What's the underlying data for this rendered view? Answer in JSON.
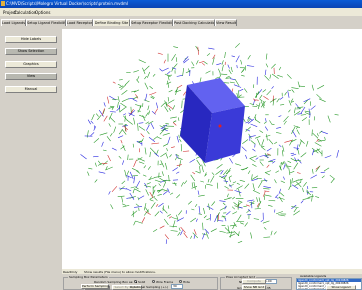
{
  "window": {
    "title": "C:\\MVD\\Scripts\\Molegro Virtual Docker\\scripts\\protein.mvdml"
  },
  "menu": {
    "items": [
      "Project",
      "Calculation",
      "Options"
    ]
  },
  "tabs": [
    "Load Ligands",
    "Setup Ligand Flexibility",
    "Load Receptor",
    "Define Binding Site",
    "Setup Receptor Flexibility",
    "Post Docking Calculation",
    "View Results"
  ],
  "sidebar": {
    "buttons": [
      "Hide Labels",
      "Show Selection",
      "Graphics",
      "View",
      "Manual"
    ]
  },
  "status": {
    "mode": "ReadOnly",
    "message": "Show results (File menu) to allow modifications."
  },
  "sampling": {
    "title": "Sampling Box Parameters",
    "random_label": "Random Sampling Box as:",
    "options": [
      "Solid",
      "Wire Frame",
      "Hide"
    ],
    "selected_option": "Solid",
    "reset_button": "Reset Box",
    "select_button": "Select By Ligand",
    "perform_button": "Perform Sampling",
    "rotational_label": "Rotational Sampling (+/-)",
    "rotational_value": "30"
  },
  "poses": {
    "title": "Pose Accepted Grid",
    "grid_label": "NB Buffer (Ang):",
    "grid_value": "1.00",
    "spacing_label": "Grid Spacing (Ang):",
    "spacing_value": "0.35",
    "compute_button": "Compute",
    "show_grid_button": "Show NB Grid"
  },
  "ligands": {
    "title": "Available Ligands",
    "items": [
      "ligand0_conformer0_opt_dg_20220826",
      "ligand0_conformer1_opt_dg_20220826",
      "ligand0_conformer2_opt_dg_20220826",
      "ligand0_conformer3_opt_dg_20220826"
    ],
    "selected_index": 0,
    "show_button": "Show Ligand"
  },
  "colors": {
    "wire_green": "#2a9a2a",
    "wire_blue": "#2a2ae0",
    "box": "#3232e6",
    "title_bar": "#0a4fcc"
  }
}
